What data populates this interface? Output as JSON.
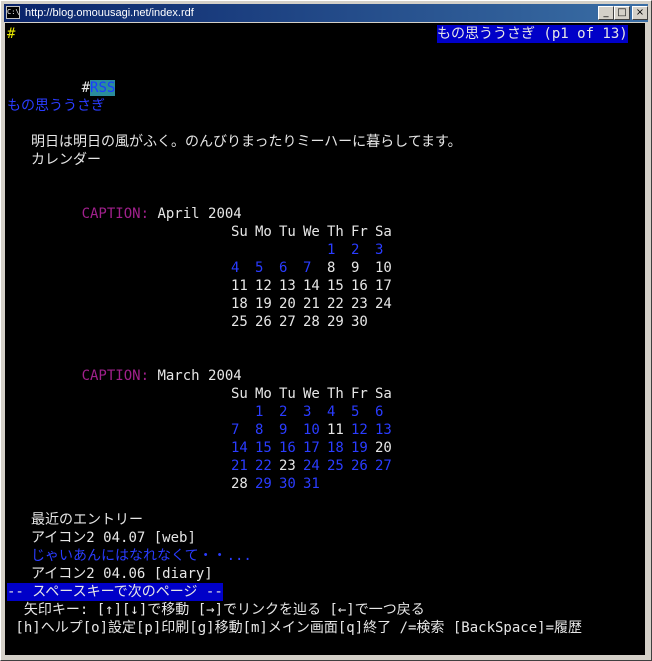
{
  "window": {
    "icon_text": "C:\\",
    "title": "http://blog.omouusagi.net/index.rdf",
    "buttons": {
      "minimize": "_",
      "maximize": "□",
      "close": "×"
    }
  },
  "header": {
    "left_mark": "#",
    "right_title": "もの思ううさぎ (p1 of 13)"
  },
  "rss_line": {
    "prefix": "#",
    "link": "RSS"
  },
  "site_link": "もの思ううさぎ",
  "intro": {
    "line1": "明日は明日の風がふく。のんびりまったりミーハーに暮らしてます。",
    "line2": "カレンダー"
  },
  "calendars": [
    {
      "caption_label": "CAPTION:",
      "caption": "April 2004",
      "days": [
        "Su",
        "Mo",
        "Tu",
        "We",
        "Th",
        "Fr",
        "Sa"
      ],
      "weeks": [
        [
          null,
          null,
          null,
          null,
          {
            "d": "1",
            "link": true
          },
          {
            "d": "2",
            "link": true
          },
          {
            "d": "3",
            "link": true
          }
        ],
        [
          {
            "d": "4",
            "link": true
          },
          {
            "d": "5",
            "link": true
          },
          {
            "d": "6",
            "link": true
          },
          {
            "d": "7",
            "link": true
          },
          {
            "d": "8"
          },
          {
            "d": "9"
          },
          {
            "d": "10"
          }
        ],
        [
          {
            "d": "11"
          },
          {
            "d": "12"
          },
          {
            "d": "13"
          },
          {
            "d": "14"
          },
          {
            "d": "15"
          },
          {
            "d": "16"
          },
          {
            "d": "17"
          }
        ],
        [
          {
            "d": "18"
          },
          {
            "d": "19"
          },
          {
            "d": "20"
          },
          {
            "d": "21"
          },
          {
            "d": "22"
          },
          {
            "d": "23"
          },
          {
            "d": "24"
          }
        ],
        [
          {
            "d": "25"
          },
          {
            "d": "26"
          },
          {
            "d": "27"
          },
          {
            "d": "28"
          },
          {
            "d": "29"
          },
          {
            "d": "30"
          },
          null
        ]
      ]
    },
    {
      "caption_label": "CAPTION:",
      "caption": "March 2004",
      "days": [
        "Su",
        "Mo",
        "Tu",
        "We",
        "Th",
        "Fr",
        "Sa"
      ],
      "weeks": [
        [
          null,
          {
            "d": "1",
            "link": true
          },
          {
            "d": "2",
            "link": true
          },
          {
            "d": "3",
            "link": true
          },
          {
            "d": "4",
            "link": true
          },
          {
            "d": "5",
            "link": true
          },
          {
            "d": "6",
            "link": true
          }
        ],
        [
          {
            "d": "7",
            "link": true
          },
          {
            "d": "8",
            "link": true
          },
          {
            "d": "9",
            "link": true
          },
          {
            "d": "10",
            "link": true
          },
          {
            "d": "11"
          },
          {
            "d": "12",
            "link": true
          },
          {
            "d": "13",
            "link": true
          }
        ],
        [
          {
            "d": "14",
            "link": true
          },
          {
            "d": "15",
            "link": true
          },
          {
            "d": "16",
            "link": true
          },
          {
            "d": "17",
            "link": true
          },
          {
            "d": "18",
            "link": true
          },
          {
            "d": "19",
            "link": true
          },
          {
            "d": "20"
          }
        ],
        [
          {
            "d": "21",
            "link": true
          },
          {
            "d": "22",
            "link": true
          },
          {
            "d": "23"
          },
          {
            "d": "24",
            "link": true
          },
          {
            "d": "25",
            "link": true
          },
          {
            "d": "26",
            "link": true
          },
          {
            "d": "27",
            "link": true
          }
        ],
        [
          {
            "d": "28"
          },
          {
            "d": "29",
            "link": true
          },
          {
            "d": "30",
            "link": true
          },
          {
            "d": "31",
            "link": true
          },
          null,
          null,
          null
        ]
      ]
    }
  ],
  "recent": {
    "heading": "最近のエントリー",
    "entry1": "アイコン2 04.07 [web]",
    "entry1_link": "じゃいあんにはなれなくて・・...",
    "entry2": "アイコン2 04.06 [diary]"
  },
  "status": {
    "prompt": "-- スペースキーで次のページ --",
    "help1": "  矢印キー: [↑][↓]で移動 [→]でリンクを辿る [←]で一つ戻る",
    "help2": " [h]ヘルプ[o]設定[p]印刷[g]移動[m]メイン画面[q]終了 /=検索 [BackSpace]=履歴"
  },
  "colors": {
    "link": "#2a3cff",
    "caption": "#a0208c",
    "highlight_bg": "#0000c8",
    "text": "#e6e6e6",
    "background": "#000000"
  }
}
